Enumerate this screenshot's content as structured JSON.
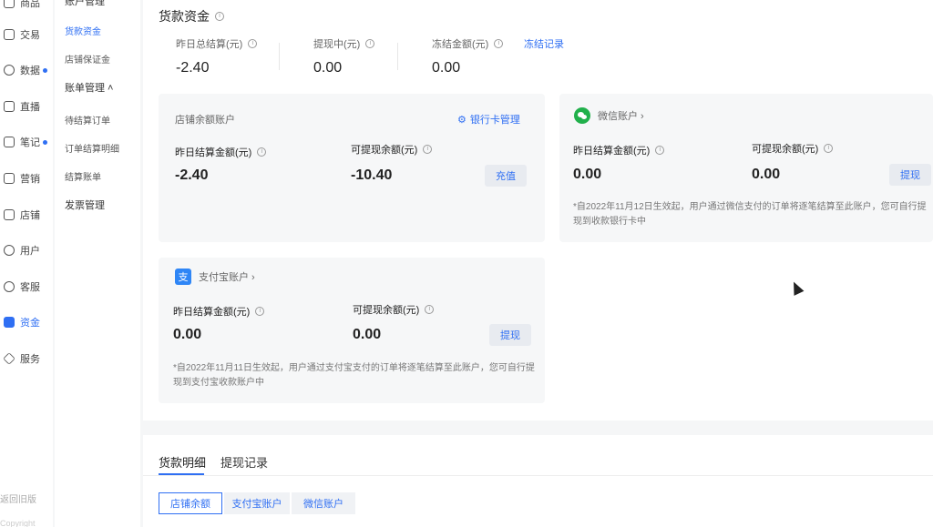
{
  "nav1": {
    "items": [
      {
        "label": "商品",
        "icon": "goods-icon"
      },
      {
        "label": "交易",
        "icon": "trade-icon"
      },
      {
        "label": "数据",
        "icon": "chart-icon",
        "dot": true
      },
      {
        "label": "直播",
        "icon": "live-icon"
      },
      {
        "label": "笔记",
        "icon": "book-icon",
        "dot": true
      },
      {
        "label": "营销",
        "icon": "megaphone-icon"
      },
      {
        "label": "店铺",
        "icon": "store-icon"
      },
      {
        "label": "用户",
        "icon": "user-icon"
      },
      {
        "label": "客服",
        "icon": "chat-icon"
      },
      {
        "label": "资金",
        "icon": "wallet-icon",
        "active": true
      },
      {
        "label": "服务",
        "icon": "diamond-icon"
      }
    ],
    "back_old": "返回旧版",
    "copyright": "Copyright"
  },
  "nav2": {
    "header": "账户管理",
    "items": [
      "货款资金",
      "店铺保证金"
    ],
    "group": "账单管理 ˄",
    "sub": [
      "待结算订单",
      "订单结算明细",
      "结算账单"
    ],
    "invoice": "发票管理"
  },
  "main": {
    "title": "货款资金",
    "summary": [
      {
        "label": "昨日总结算(元)",
        "value": "-2.40"
      },
      {
        "label": "提现中(元)",
        "value": "0.00"
      },
      {
        "label": "冻结金额(元)",
        "value": "0.00"
      }
    ],
    "freeze_link": "冻结记录",
    "store": {
      "title": "店铺余额账户",
      "bank_link": "银行卡管理",
      "yesterday_label": "昨日结算金额(元)",
      "yesterday_value": "-2.40",
      "withdraw_label": "可提现余额(元)",
      "withdraw_value": "-10.40",
      "button": "充值"
    },
    "wechat": {
      "title": "微信账户 ›",
      "yesterday_label": "昨日结算金额(元)",
      "yesterday_value": "0.00",
      "withdraw_label": "可提现余额(元)",
      "withdraw_value": "0.00",
      "button": "提现",
      "note": "*自2022年11月12日生效起，用户通过微信支付的订单将逐笔结算至此账户，您可自行提现到收款银行卡中"
    },
    "alipay": {
      "title": "支付宝账户 ›",
      "icon_char": "支",
      "yesterday_label": "昨日结算金额(元)",
      "yesterday_value": "0.00",
      "withdraw_label": "可提现余额(元)",
      "withdraw_value": "0.00",
      "button": "提现",
      "note": "*自2022年11月11日生效起，用户通过支付宝支付的订单将逐笔结算至此账户，您可自行提现到支付宝收款账户中"
    }
  },
  "bottom": {
    "tabs": [
      "货款明细",
      "提现记录"
    ],
    "segments": [
      "店铺余额",
      "支付宝账户",
      "微信账户"
    ]
  },
  "colors": {
    "accent": "#2f6ff3",
    "wechat": "#21b04b",
    "alipay": "#2f86f6"
  }
}
